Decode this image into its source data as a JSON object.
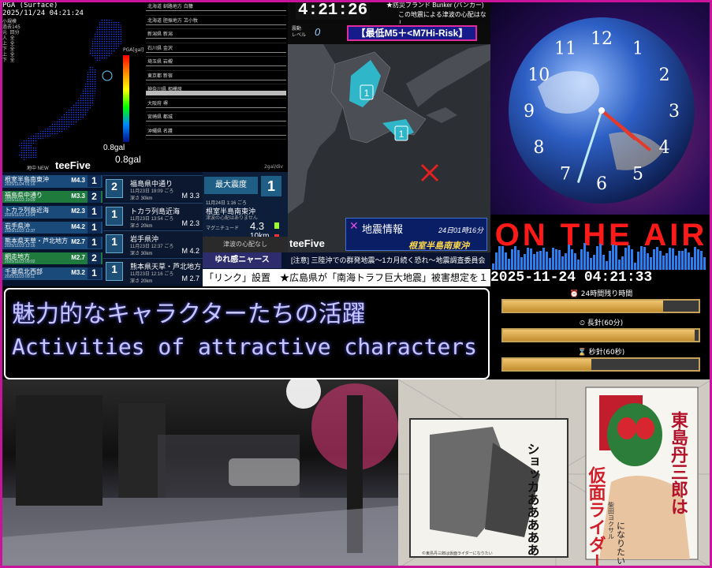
{
  "pga": {
    "title": "PGA (Surface)",
    "timestamp": "2025/11/24 04:21:24",
    "scale_list": [
      "小規模",
      "過去145",
      "元 回分",
      "人 全",
      "上 全",
      "下 全",
      "上 全",
      "下 全"
    ],
    "unit": "PGA[gal]",
    "gal_top": "0.8gal",
    "gal_bottom": "0.8gal",
    "hokkaido_label": "釧路 厚岸 町",
    "axis_unit": "2gal/div",
    "stations": [
      "北海道 釧路地方 白糠",
      "北海道 胆振地方 苫小牧",
      "新潟県 新潟",
      "石川県 金沢",
      "埼玉県 岩槻",
      "東京都 新宿",
      "神奈川県 相模原",
      "大阪府 堺",
      "宮崎県 都城",
      "沖縄県 名護"
    ]
  },
  "quake_list": {
    "footer": "地中 NEW",
    "brand": "teeFive",
    "rows": [
      {
        "name": "根室半島南東沖",
        "time": "2025/11/24 01:16",
        "mag": "M4.3",
        "intensity": "1"
      },
      {
        "name": "福島県中通り",
        "time": "2025/11/23 19:09",
        "mag": "M3.3",
        "intensity": "2"
      },
      {
        "name": "トカラ列島近海",
        "time": "2025/11/23 13:54",
        "mag": "M2.3",
        "intensity": "1"
      },
      {
        "name": "岩手県沖",
        "time": "2025/11/23 12:37",
        "mag": "M4.2",
        "intensity": "1"
      },
      {
        "name": "熊本県天草・芦北地方",
        "time": "2025/11/23 12:16",
        "mag": "M2.7",
        "intensity": "1"
      },
      {
        "name": "網走地方",
        "time": "2025/11/23 09:02",
        "mag": "M2.7",
        "intensity": "2"
      },
      {
        "name": "千葉県北西部",
        "time": "2025/11/23 09:11",
        "mag": "M3.2",
        "intensity": "1"
      }
    ],
    "cards": [
      {
        "intensity": "2",
        "name": "福島県中通り",
        "time": "11月23日 19:09 ごろ",
        "depth": "深さ 30km",
        "mag": "M 3.3"
      },
      {
        "intensity": "1",
        "name": "トカラ列島近海",
        "time": "11月23日 13:54 ごろ",
        "depth": "深さ 20km",
        "mag": "M 2.3"
      },
      {
        "intensity": "1",
        "name": "岩手県沖",
        "time": "11月23日 12:37 ごろ",
        "depth": "深さ 30km",
        "mag": "M 4.2"
      },
      {
        "intensity": "1",
        "name": "熊本県天草・芦北地方",
        "time": "11月23日 12:16 ごろ",
        "depth": "深さ 20km",
        "mag": "M 2.7"
      }
    ],
    "max": {
      "label": "最大震度",
      "value": "1",
      "time": "11月24日 1:16 ごろ",
      "epicenter": "根室半島南東沖",
      "sub": "津波の心配はありません",
      "mag_label": "マグニチュード",
      "mag_value": "4.3",
      "depth_label": "深さ",
      "depth_value": "10km"
    },
    "tsunami": "津波の心配なし",
    "yure": "ゆれ感ニャース"
  },
  "map": {
    "clock": "4:21:26",
    "channel": "★防災ブランド Bunker (バンカー)",
    "no_threat": "この地震による津波の心配はなし",
    "level_key": "震動\nレベル",
    "level_value": "0",
    "risk": "【最低M5＋<M7Hi-Risk】",
    "pins": [
      "1",
      "1"
    ],
    "info_title": "地震情報",
    "info_date": "24日01時16分",
    "info_epicenter": "根室半島南東沖",
    "brand": "teeFive",
    "notice": "[注意] 三陸沖での群発地震〜1カ月続く恐れ〜地震調査委員会"
  },
  "ticker": "「リンク」設置　★広島県が「南海トラフ巨大地震」被害想定を１",
  "clock_panel": {
    "numerals": [
      "12",
      "1",
      "2",
      "3",
      "4",
      "5",
      "6",
      "7",
      "8",
      "9",
      "10",
      "11"
    ],
    "hands": {
      "hour": 4,
      "minute": 21,
      "second": 33
    }
  },
  "on_air": "ON THE AIR",
  "datetime": "2025-11-24 04:21:33",
  "meters": [
    {
      "label": "⏰ 24時間残り時間",
      "fraction": 0.82
    },
    {
      "label": "⏲ 長針(60分)",
      "fraction": 0.98
    },
    {
      "label": "⌛ 秒針(60秒)",
      "fraction": 0.45
    }
  ],
  "caption": {
    "jp": "魅力的なキャラクターたちの活躍",
    "en": "Activities of attractive characters"
  },
  "manga": {
    "title_vertical": "東島丹三郎は",
    "big_title": "仮面ライダー",
    "subtitle_vertical": "になりたい",
    "author": "柴田ヨクサル",
    "sfx": "ショッカあああああ",
    "credit": "©東島丹三郎は仮面ライダーになりたい"
  },
  "colors": {
    "frame": "#c8149a",
    "caption_text": "#c8c6ff",
    "risk_border": "#e12b9a",
    "pin_fill": "#2fb7c9"
  }
}
